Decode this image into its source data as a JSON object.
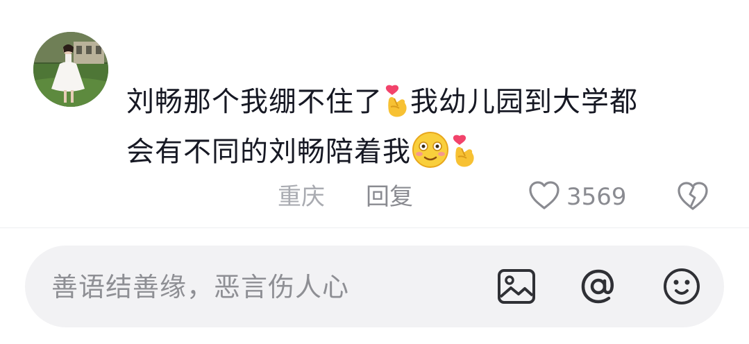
{
  "comment": {
    "line1": "刘畅那个我绷不住了",
    "line1b": "我幼儿园到大学都",
    "line2": "会有不同的刘畅陪着我",
    "emojis": [
      "finger-heart-emoji",
      "smiling-blush-emoji",
      "finger-heart-emoji"
    ],
    "location": "重庆",
    "reply_label": "回复",
    "like_count": "3569"
  },
  "input_bar": {
    "placeholder": "善语结善缘，恶言伤人心",
    "icons": [
      "image-icon",
      "at-icon",
      "emoji-icon"
    ]
  },
  "colors": {
    "text": "#161823",
    "meta_text": "#8a8b91",
    "location_text": "#a9abb1",
    "input_bg": "#f2f2f4",
    "icon": "#2f3035"
  }
}
